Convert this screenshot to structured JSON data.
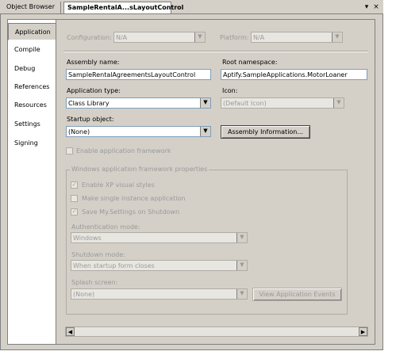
{
  "tabs": {
    "inactive_label": "Object Browser",
    "active_label": "SampleRentalA...sLayoutControl",
    "dropdown_glyph": "▾",
    "close_glyph": "×"
  },
  "sidebar": {
    "items": [
      {
        "label": "Application"
      },
      {
        "label": "Compile"
      },
      {
        "label": "Debug"
      },
      {
        "label": "References"
      },
      {
        "label": "Resources"
      },
      {
        "label": "Settings"
      },
      {
        "label": "Signing"
      }
    ]
  },
  "form": {
    "configuration": {
      "label": "Configuration:",
      "value": "N/A"
    },
    "platform": {
      "label": "Platform:",
      "value": "N/A"
    },
    "assembly_name": {
      "label": "Assembly name:",
      "value": "SampleRentalAgreementsLayoutControl"
    },
    "root_namespace": {
      "label": "Root namespace:",
      "value": "Aptify.SampleApplications.MotorLoaner"
    },
    "application_type": {
      "label": "Application type:",
      "value": "Class Library"
    },
    "icon": {
      "label": "Icon:",
      "value": "(Default Icon)"
    },
    "startup_object": {
      "label": "Startup object:",
      "value": "(None)"
    },
    "assembly_info_button": "Assembly Information...",
    "enable_framework": {
      "label": "Enable application framework",
      "checked": false
    }
  },
  "group": {
    "title": "Windows application framework properties",
    "enable_xp_styles": {
      "label": "Enable XP visual styles",
      "checked": true
    },
    "single_instance": {
      "label": "Make single instance application",
      "checked": false
    },
    "save_settings": {
      "label": "Save My.Settings on Shutdown",
      "checked": true
    },
    "auth_mode": {
      "label": "Authentication mode:",
      "value": "Windows"
    },
    "shutdown_mode": {
      "label": "Shutdown mode:",
      "value": "When startup form closes"
    },
    "splash_screen": {
      "label": "Splash screen:",
      "value": "(None)"
    },
    "view_events_button": "View Application Events"
  },
  "icons": {
    "check": "✓",
    "arrow_down": "▼",
    "arrow_left": "◀",
    "arrow_right": "▶"
  }
}
